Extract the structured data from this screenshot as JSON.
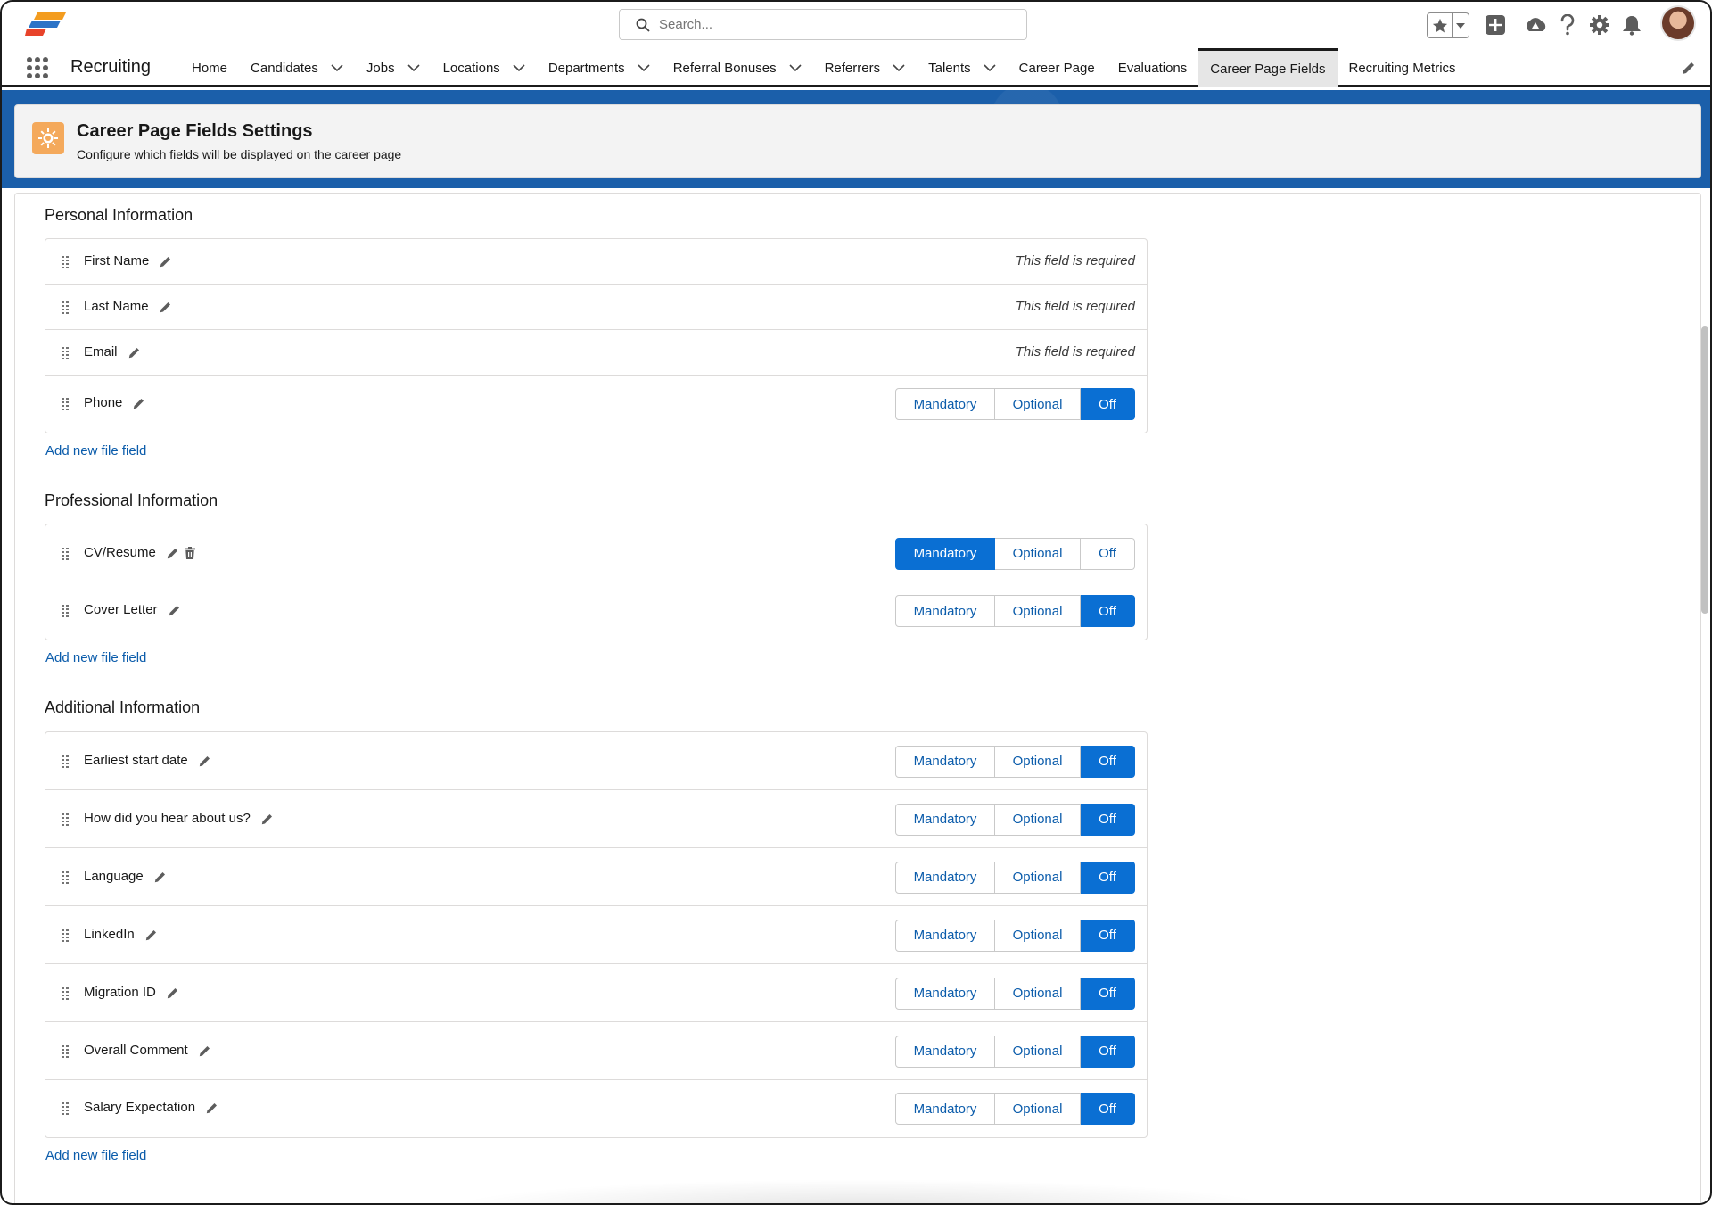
{
  "header": {
    "search_placeholder": "Search...",
    "icons": [
      "favorites-star-icon",
      "favorites-caret-icon",
      "global-add-icon",
      "trailhead-icon",
      "help-icon",
      "setup-gear-icon",
      "notifications-bell-icon",
      "user-avatar"
    ]
  },
  "nav": {
    "app_name": "Recruiting",
    "items": [
      {
        "label": "Home",
        "dropdown": false
      },
      {
        "label": "Candidates",
        "dropdown": true
      },
      {
        "label": "Jobs",
        "dropdown": true
      },
      {
        "label": "Locations",
        "dropdown": true
      },
      {
        "label": "Departments",
        "dropdown": true
      },
      {
        "label": "Referral Bonuses",
        "dropdown": true
      },
      {
        "label": "Referrers",
        "dropdown": true
      },
      {
        "label": "Talents",
        "dropdown": true
      },
      {
        "label": "Career Page",
        "dropdown": false
      },
      {
        "label": "Evaluations",
        "dropdown": false
      },
      {
        "label": "Career Page Fields",
        "dropdown": false,
        "active": true
      },
      {
        "label": "Recruiting Metrics",
        "dropdown": false
      }
    ]
  },
  "page_header": {
    "title": "Career Page Fields Settings",
    "subtitle": "Configure which fields will be displayed on the career page"
  },
  "segment_labels": {
    "mandatory": "Mandatory",
    "optional": "Optional",
    "off": "Off"
  },
  "sections": [
    {
      "title": "Personal Information",
      "add_link": "Add new file field",
      "fields": [
        {
          "name": "First Name",
          "required_text": "This field is required"
        },
        {
          "name": "Last Name",
          "required_text": "This field is required"
        },
        {
          "name": "Email",
          "required_text": "This field is required"
        },
        {
          "name": "Phone",
          "state": "Off"
        }
      ]
    },
    {
      "title": "Professional Information",
      "add_link": "Add new file field",
      "fields": [
        {
          "name": "CV/Resume",
          "state": "Mandatory",
          "deletable": true
        },
        {
          "name": "Cover Letter",
          "state": "Off"
        }
      ]
    },
    {
      "title": "Additional Information",
      "add_link": "Add new file field",
      "fields": [
        {
          "name": "Earliest start date",
          "state": "Off"
        },
        {
          "name": "How did you hear about us?",
          "state": "Off"
        },
        {
          "name": "Language",
          "state": "Off"
        },
        {
          "name": "LinkedIn",
          "state": "Off"
        },
        {
          "name": "Migration ID",
          "state": "Off"
        },
        {
          "name": "Overall Comment",
          "state": "Off"
        },
        {
          "name": "Salary Expectation",
          "state": "Off"
        }
      ]
    }
  ],
  "colors": {
    "brand_blue": "#0a6fd3",
    "link_blue": "#0b5cab",
    "header_icon_orange": "#f4a95b"
  }
}
